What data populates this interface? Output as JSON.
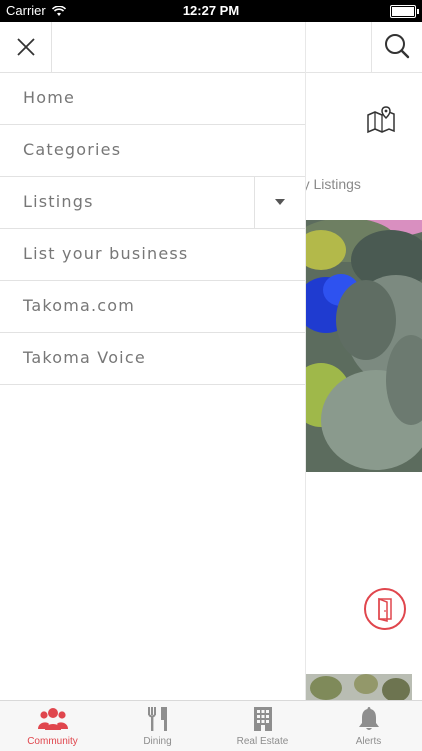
{
  "status_bar": {
    "carrier": "Carrier",
    "time": "12:27 PM"
  },
  "background": {
    "subtitle": "unity Listings"
  },
  "drawer": {
    "menu": [
      {
        "label": "Home"
      },
      {
        "label": "Categories"
      },
      {
        "label": "Listings"
      },
      {
        "label": "List your business"
      },
      {
        "label": "Takoma.com"
      },
      {
        "label": "Takoma Voice"
      }
    ]
  },
  "tabbar": {
    "tabs": [
      {
        "label": "Community",
        "icon": "people-icon",
        "active": true
      },
      {
        "label": "Dining",
        "icon": "fork-knife-icon",
        "active": false
      },
      {
        "label": "Real Estate",
        "icon": "building-icon",
        "active": false
      },
      {
        "label": "Alerts",
        "icon": "bell-icon",
        "active": false
      }
    ]
  },
  "colors": {
    "accent": "#e0464d",
    "text": "#777777",
    "divider": "#e2e2e2"
  }
}
